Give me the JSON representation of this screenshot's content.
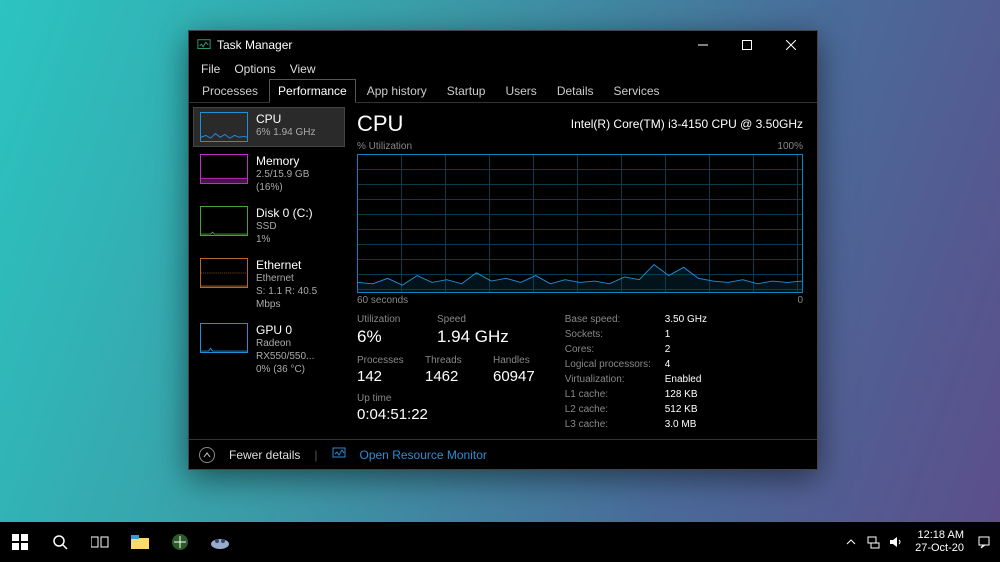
{
  "window": {
    "title": "Task Manager",
    "menus": [
      "File",
      "Options",
      "View"
    ],
    "tabs": [
      "Processes",
      "Performance",
      "App history",
      "Startup",
      "Users",
      "Details",
      "Services"
    ],
    "active_tab": 1
  },
  "sidebar": {
    "items": [
      {
        "title": "CPU",
        "sub": "6% 1.94 GHz",
        "color": "#1e90d8"
      },
      {
        "title": "Memory",
        "sub": "2.5/15.9 GB (16%)",
        "color": "#c030c0"
      },
      {
        "title": "Disk 0 (C:)",
        "sub1": "SSD",
        "sub2": "1%",
        "color": "#4aa03a"
      },
      {
        "title": "Ethernet",
        "sub1": "Ethernet",
        "sub2": "S: 1.1 R: 40.5 Mbps",
        "color": "#b06a2a"
      },
      {
        "title": "GPU 0",
        "sub1": "Radeon RX550/550...",
        "sub2": "0% (36 °C)",
        "color": "#1e90d8"
      }
    ],
    "selected": 0
  },
  "main": {
    "heading": "CPU",
    "cpu_name": "Intel(R) Core(TM) i3-4150 CPU @ 3.50GHz",
    "axis_top_left": "% Utilization",
    "axis_top_right": "100%",
    "axis_bottom_left": "60 seconds",
    "axis_bottom_right": "0",
    "stats_left": {
      "labels1": [
        "Utilization",
        "Speed"
      ],
      "values1": [
        "6%",
        "1.94 GHz"
      ],
      "labels2": [
        "Processes",
        "Threads",
        "Handles"
      ],
      "values2": [
        "142",
        "1462",
        "60947"
      ],
      "label3": "Up time",
      "value3": "0:04:51:22"
    },
    "stats_right": [
      {
        "k": "Base speed:",
        "v": "3.50 GHz"
      },
      {
        "k": "Sockets:",
        "v": "1"
      },
      {
        "k": "Cores:",
        "v": "2"
      },
      {
        "k": "Logical processors:",
        "v": "4"
      },
      {
        "k": "Virtualization:",
        "v": "Enabled"
      },
      {
        "k": "L1 cache:",
        "v": "128 KB"
      },
      {
        "k": "L2 cache:",
        "v": "512 KB"
      },
      {
        "k": "L3 cache:",
        "v": "3.0 MB"
      }
    ]
  },
  "footer": {
    "fewer": "Fewer details",
    "resmon": "Open Resource Monitor"
  },
  "taskbar": {
    "time": "12:18 AM",
    "date": "27-Oct-20"
  },
  "chart_data": {
    "type": "line",
    "title": "CPU % Utilization",
    "ylabel": "% Utilization",
    "xlabel": "seconds ago",
    "ylim": [
      0,
      100
    ],
    "xlim": [
      60,
      0
    ],
    "x": [
      60,
      58,
      56,
      54,
      52,
      50,
      48,
      46,
      44,
      42,
      40,
      38,
      36,
      34,
      32,
      30,
      28,
      26,
      24,
      22,
      20,
      18,
      16,
      14,
      12,
      10,
      8,
      6,
      4,
      2,
      0
    ],
    "values": [
      7,
      6,
      10,
      5,
      12,
      7,
      9,
      6,
      14,
      8,
      10,
      7,
      12,
      6,
      9,
      7,
      8,
      6,
      11,
      9,
      20,
      12,
      18,
      10,
      8,
      7,
      9,
      6,
      8,
      7,
      8
    ]
  }
}
